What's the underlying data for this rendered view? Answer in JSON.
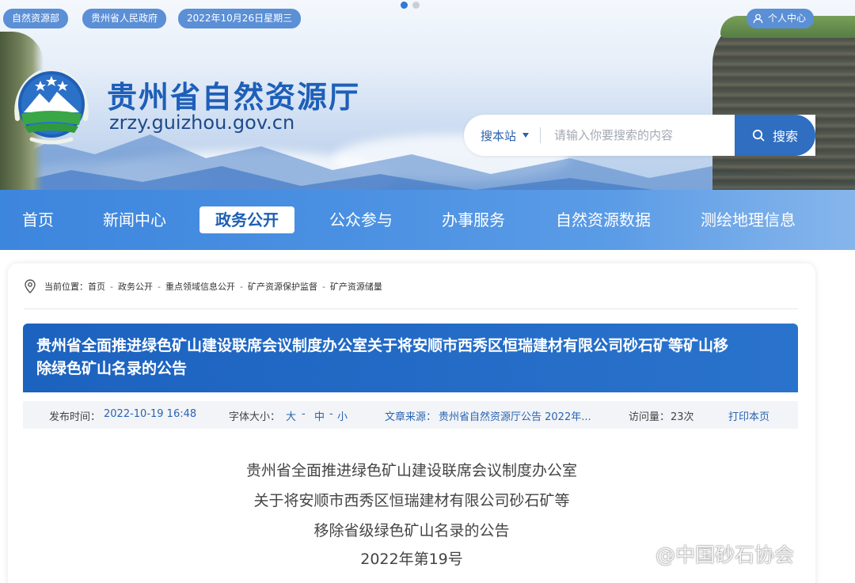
{
  "colors": {
    "primary": "#1e5fb8",
    "nav": "#4a90e2",
    "pill": "#5b8fd6",
    "search_btn": "#2f6ec0"
  },
  "header": {
    "pills": [
      "自然资源部",
      "贵州省人民政府",
      "2022年10月26日星期三"
    ],
    "user_center": "个人中心",
    "site_title": "贵州省自然资源厅",
    "site_domain": "zrzy.guizhou.gov.cn",
    "logo_icon": "emblem-logo",
    "search": {
      "scope": "搜本站",
      "placeholder": "请输入你要搜索的内容",
      "button": "搜索"
    }
  },
  "nav": {
    "items": [
      "首页",
      "新闻中心",
      "政务公开",
      "公众参与",
      "办事服务",
      "自然资源数据",
      "测绘地理信息"
    ],
    "active_index": 2
  },
  "breadcrumb": {
    "label": "当前位置：",
    "items": [
      "首页",
      "政务公开",
      "重点领域信息公开",
      "矿产资源保护监督",
      "矿产资源储量"
    ]
  },
  "article": {
    "title_line1": "贵州省全面推进绿色矿山建设联席会议制度办公室关于将安顺市西秀区恒瑞建材有限公司砂石矿等矿山移",
    "title_line2": "除绿色矿山名录的公告",
    "meta": {
      "publish_label": "发布时间：",
      "publish_value": "2022-10-19 16:48",
      "font_label": "字体大小：",
      "font_large": "大",
      "font_mid": "中",
      "font_small": "小",
      "source_label": "文章来源：",
      "source_value": "贵州省自然资源厅公告 2022年...",
      "views_label": "访问量：",
      "views_value": "23次",
      "print": "打印本页"
    },
    "body_lines": [
      "贵州省全面推进绿色矿山建设联席会议制度办公室",
      "关于将安顺市西秀区恒瑞建材有限公司砂石矿等",
      "移除省级绿色矿山名录的公告",
      "2022年第19号"
    ]
  },
  "watermark": "@中国砂石协会"
}
